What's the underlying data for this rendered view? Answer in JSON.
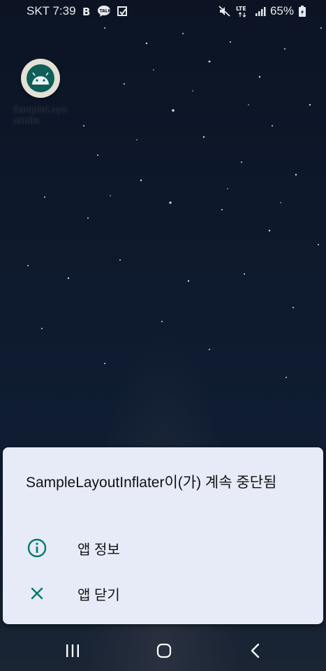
{
  "status_bar": {
    "carrier_time": "SKT 7:39",
    "network_type": "LTE",
    "battery": "65%",
    "left_icons": [
      "b-icon",
      "talk-icon",
      "check-icon"
    ],
    "right_icons": [
      "mute-icon",
      "lte-icon",
      "signal-icon",
      "battery-icon"
    ]
  },
  "home": {
    "app_label": "SampleLayoutInfla"
  },
  "dialog": {
    "title": "SampleLayoutInflater이(가) 계속 중단됨",
    "options": [
      {
        "label": "앱 정보",
        "icon": "info-icon"
      },
      {
        "label": "앱 닫기",
        "icon": "close-icon"
      }
    ],
    "accent_color": "#00796b",
    "background": "#e6ebf7"
  },
  "nav_bar": {
    "buttons": [
      "recents-button",
      "home-button",
      "back-button"
    ]
  }
}
